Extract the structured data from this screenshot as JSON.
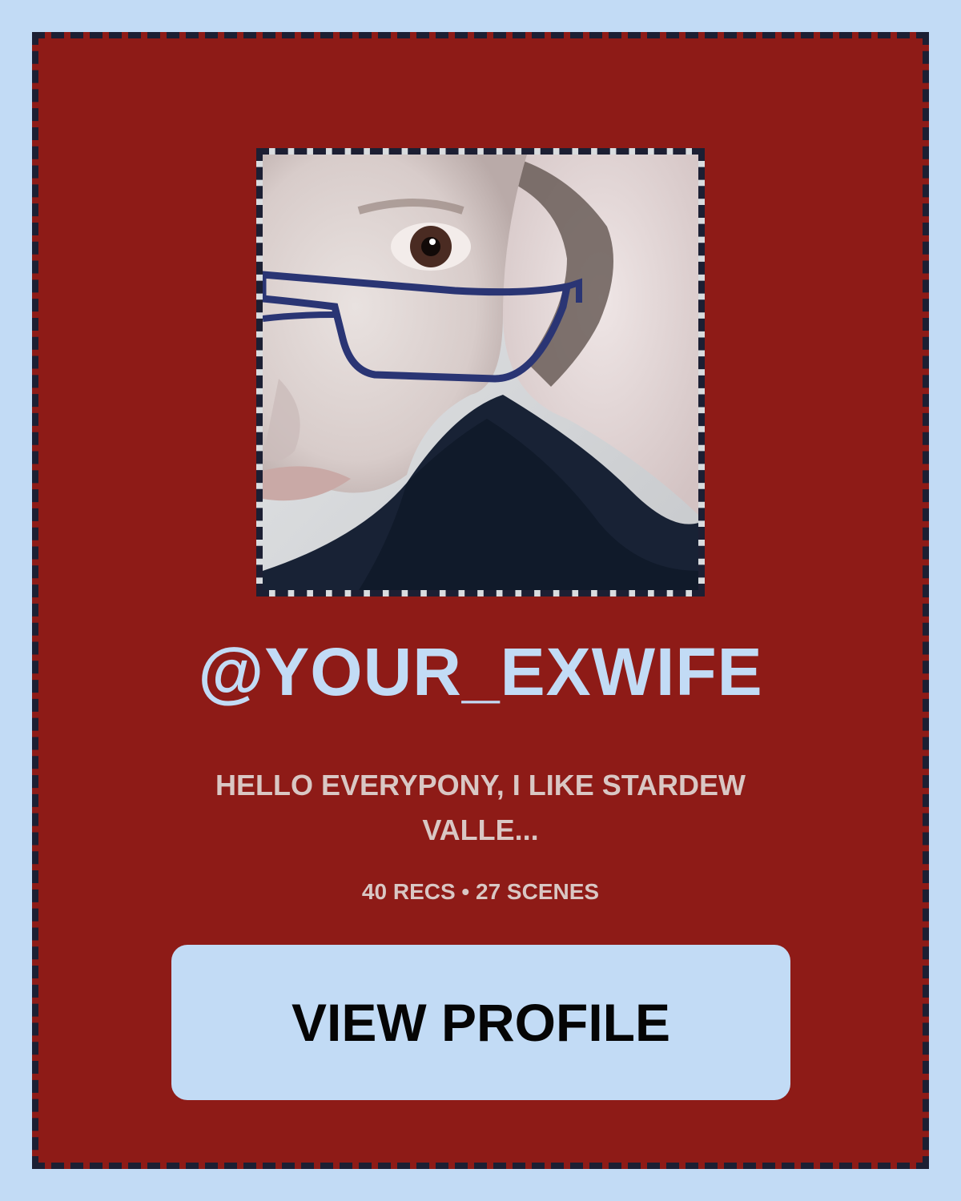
{
  "profile": {
    "username": "@YOUR_EXWIFE",
    "bio": "HELLO EVERYPONY, I LIKE STARDEW VALLE...",
    "stats": "40 RECS • 27 SCENES",
    "avatar_alt": "profile-photo"
  },
  "actions": {
    "view_profile_label": "VIEW PROFILE"
  },
  "colors": {
    "page_background": "#c2dbf5",
    "card_background": "#8e1b17",
    "dash_border": "#1c1f33",
    "username_text": "#c2dbf5",
    "secondary_text": "#d9c7c4",
    "button_background": "#c2dbf5",
    "button_text": "#050505"
  }
}
